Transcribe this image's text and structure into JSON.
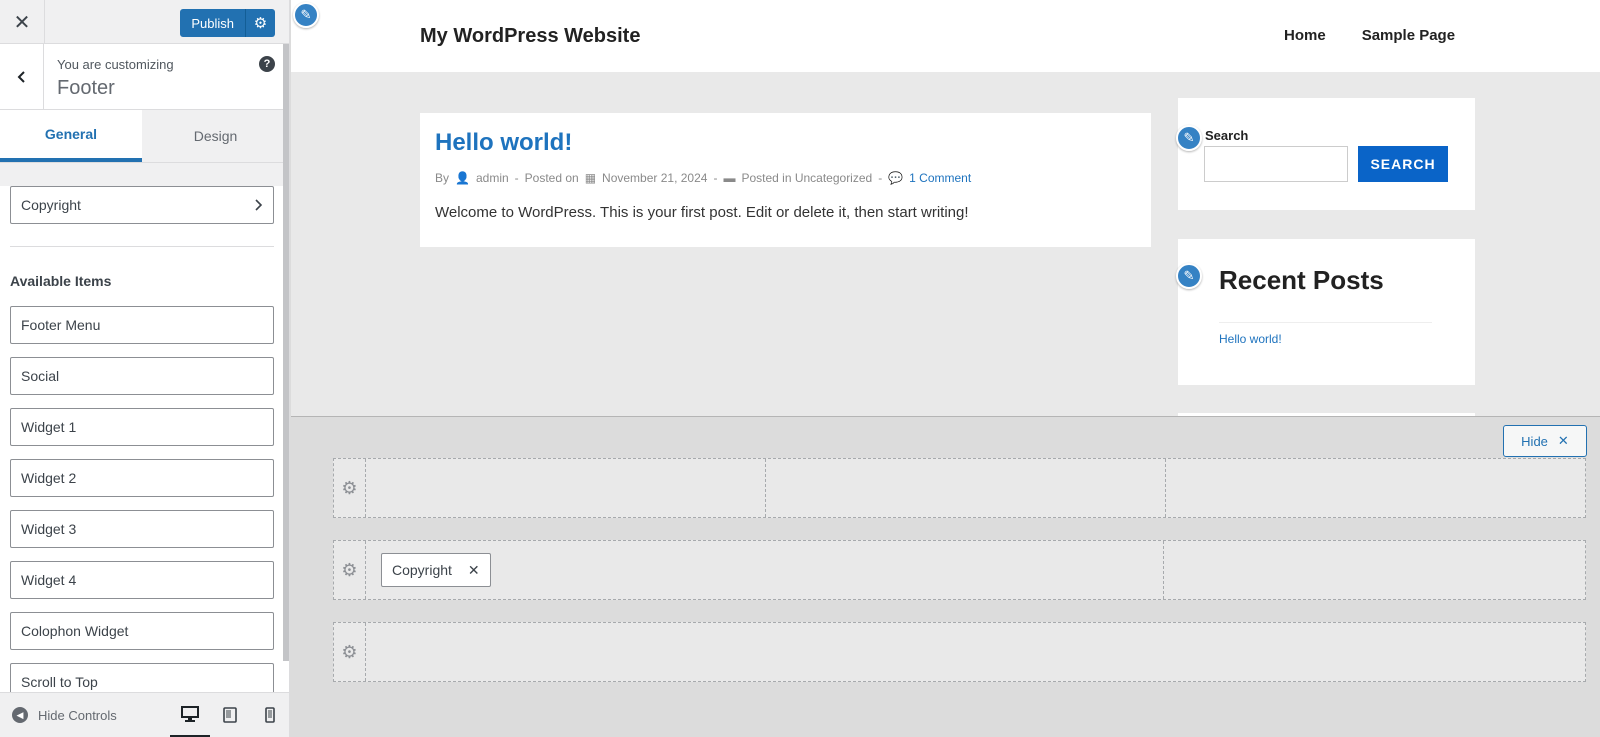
{
  "customizer": {
    "close_icon": "close-icon",
    "publish_label": "Publish",
    "subtitle": "You are customizing",
    "title": "Footer",
    "tabs": [
      {
        "label": "General",
        "active": true
      },
      {
        "label": "Design",
        "active": false
      }
    ],
    "copyright_item": "Copyright",
    "available_items_label": "Available Items",
    "available_items": [
      "Footer Menu",
      "Social",
      "Widget 1",
      "Widget 2",
      "Widget 3",
      "Widget 4",
      "Colophon Widget",
      "Scroll to Top"
    ],
    "hide_controls_label": "Hide Controls",
    "accent_color": "#2271b1"
  },
  "site": {
    "title": "My WordPress Website",
    "nav": [
      "Home",
      "Sample Page"
    ],
    "post": {
      "title": "Hello world!",
      "by": "By",
      "author": "admin",
      "posted_on": "Posted on",
      "date": "November 21, 2024",
      "posted_in": "Posted in Uncategorized",
      "comments": "1 Comment",
      "sep": "-",
      "body": "Welcome to WordPress. This is your first post. Edit or delete it, then start writing!"
    },
    "search": {
      "label": "Search",
      "button": "SEARCH"
    },
    "recent_posts": {
      "title": "Recent Posts",
      "items": [
        "Hello world!"
      ]
    },
    "link_color": "#1e73be"
  },
  "footer_builder": {
    "hide_label": "Hide",
    "rows": [
      {
        "columns": 3,
        "items": []
      },
      {
        "columns": 2,
        "items": [
          "Copyright"
        ]
      },
      {
        "columns": 1,
        "items": []
      }
    ]
  }
}
